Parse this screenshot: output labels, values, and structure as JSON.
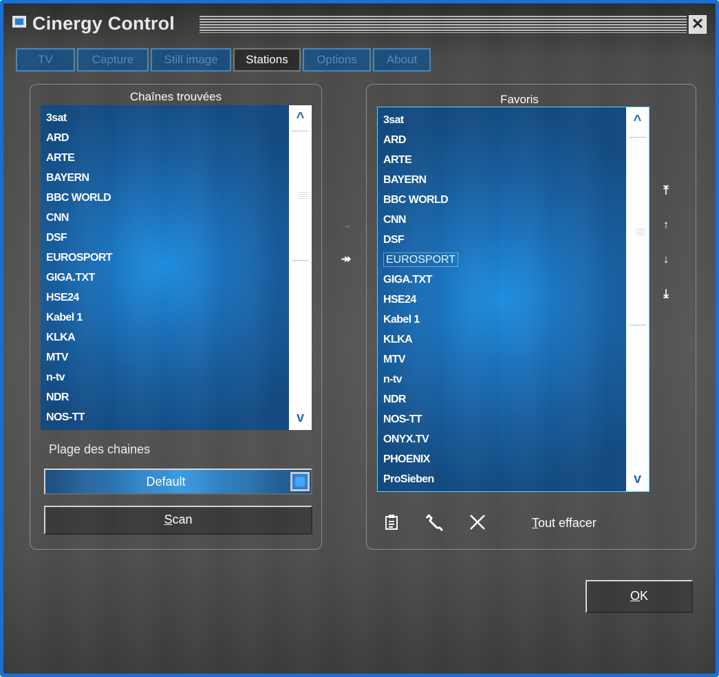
{
  "window": {
    "title": "Cinergy Control"
  },
  "tabs": [
    {
      "label": "TV"
    },
    {
      "label": "Capture"
    },
    {
      "label": "Still image"
    },
    {
      "label": "Stations"
    },
    {
      "label": "Options"
    },
    {
      "label": "About"
    }
  ],
  "active_tab": "Stations",
  "found_channels": {
    "title": "Chaînes trouvées",
    "items": [
      "3sat",
      "ARD",
      "ARTE",
      "BAYERN",
      "BBC WORLD",
      "CNN",
      "DSF",
      "EUROSPORT",
      "GIGA.TXT",
      "HSE24",
      "Kabel 1",
      "KLKA",
      "MTV",
      "n-tv",
      "NDR",
      "NOS-TT"
    ],
    "range_label": "Plage des chaines",
    "range_value": "Default",
    "scan_label": "Scan",
    "scan_accel": "S",
    "scan_rest": "can"
  },
  "transfer": {
    "add_one": "→",
    "add_all": "↠"
  },
  "favorites": {
    "title": "Favoris",
    "items": [
      "3sat",
      "ARD",
      "ARTE",
      "BAYERN",
      "BBC WORLD",
      "CNN",
      "DSF",
      "EUROSPORT",
      "GIGA.TXT",
      "HSE24",
      "Kabel 1",
      "KLKA",
      "MTV",
      "n-tv",
      "NDR",
      "NOS-TT",
      "ONYX.TV",
      "PHOENIX",
      "ProSieben"
    ],
    "selected": "EUROSPORT",
    "clear_all_accel": "T",
    "clear_all_rest": "out effacer"
  },
  "reorder": {
    "top": "⤒",
    "up": "↑",
    "down": "↓",
    "bottom": "⤓"
  },
  "ok_button": {
    "accel": "O",
    "rest": "K"
  },
  "icons": {
    "title": "tv-window-icon",
    "close": "close-icon",
    "properties": "properties-icon",
    "edit": "wrench-icon",
    "delete": "delete-x-icon"
  }
}
